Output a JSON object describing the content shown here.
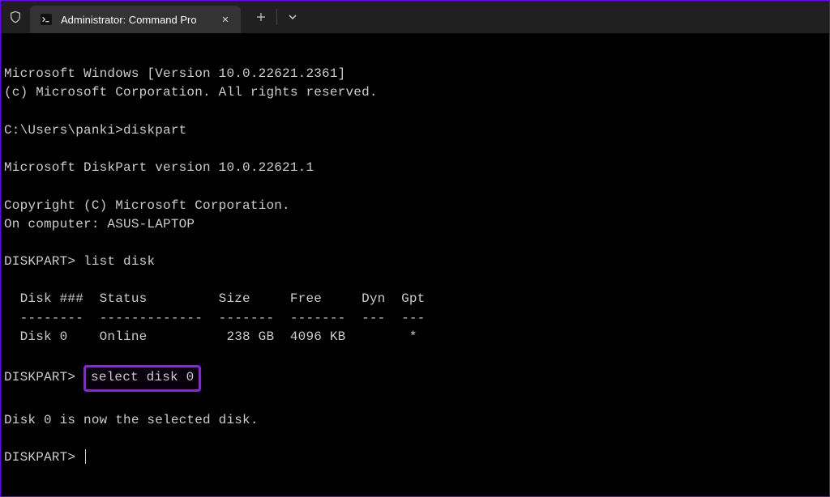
{
  "titlebar": {
    "tab_title": "Administrator: Command Pro",
    "new_tab_label": "+",
    "dropdown_label": "⌄",
    "close_label": "✕"
  },
  "terminal": {
    "line1": "Microsoft Windows [Version 10.0.22621.2361]",
    "line2": "(c) Microsoft Corporation. All rights reserved.",
    "prompt1_path": "C:\\Users\\panki>",
    "prompt1_cmd": "diskpart",
    "line_dp_ver": "Microsoft DiskPart version 10.0.22621.1",
    "line_copyright": "Copyright (C) Microsoft Corporation.",
    "line_computer": "On computer: ASUS-LAPTOP",
    "dp_prompt": "DISKPART>",
    "cmd_list": "list disk",
    "table_header": "  Disk ###  Status         Size     Free     Dyn  Gpt",
    "table_div": "  --------  -------------  -------  -------  ---  ---",
    "table_row1": "  Disk 0    Online          238 GB  4096 KB        *",
    "cmd_select": "select disk 0",
    "result_select": "Disk 0 is now the selected disk.",
    "cmd_final": ""
  }
}
